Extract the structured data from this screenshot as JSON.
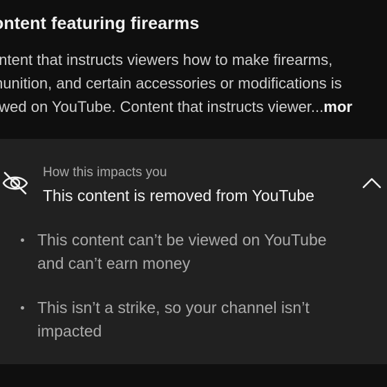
{
  "policy": {
    "title": "ontent featuring firearms",
    "description_lines": [
      "ontent that instructs viewers how to make firearms,",
      "munition, and certain accessories or modifications is",
      "owed on YouTube. Content that instructs viewer..."
    ],
    "more_label": "mor"
  },
  "impact": {
    "subtitle": "How this impacts you",
    "title": "This content is removed from YouTube",
    "icon": "eye-off-icon",
    "collapse_icon": "chevron-up-icon",
    "bullets": [
      {
        "lines": [
          "This content can’t be viewed on YouTube",
          "and can’t earn money"
        ]
      },
      {
        "lines": [
          "This isn’t a strike, so your channel isn’t",
          "impacted"
        ]
      }
    ]
  },
  "colors": {
    "background": "#0f0f0f",
    "card": "#212121",
    "primary_text": "#f1f1f1",
    "secondary_text": "#aaaaaa"
  }
}
